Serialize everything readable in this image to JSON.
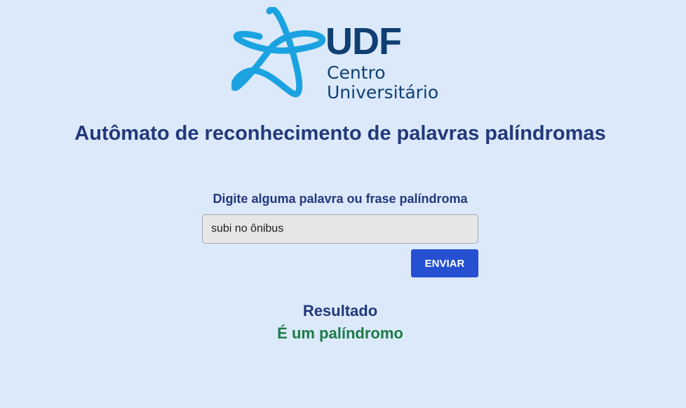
{
  "logo": {
    "icon": "star-icon",
    "brand": "UDF",
    "subtitle_line1": "Centro",
    "subtitle_line2": "Universitário",
    "star_color": "#1aa3e0",
    "text_color": "#0f3f73"
  },
  "header": {
    "title": "Autômato de reconhecimento de palavras palíndromas"
  },
  "form": {
    "label": "Digite alguma palavra ou frase palíndroma",
    "input_value": "subi no ônibus",
    "submit_label": "ENVIAR",
    "button_color": "#2550d2"
  },
  "result": {
    "title": "Resultado",
    "value": "É um palíndromo",
    "value_color": "#1c7a47"
  },
  "colors": {
    "background": "#dbe9fb",
    "heading": "#23387a"
  }
}
